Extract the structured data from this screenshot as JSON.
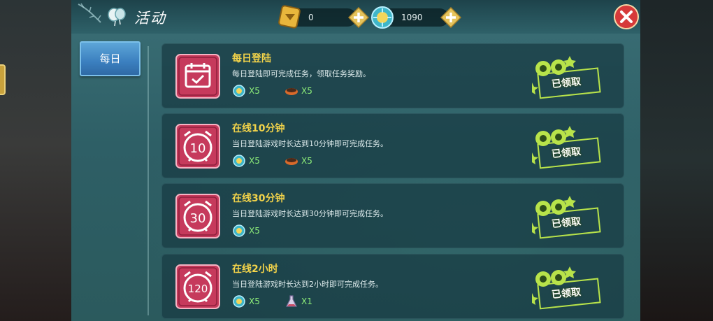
{
  "header": {
    "title": "活动",
    "gold": {
      "value": "0",
      "icon": "gold-ingot-icon"
    },
    "coins": {
      "value": "1090",
      "icon": "coin-icon"
    }
  },
  "tabs": [
    {
      "label": "每日",
      "selected": true
    }
  ],
  "tasks": [
    {
      "icon_text": "",
      "icon": "calendar-icon",
      "title": "每日登陆",
      "desc": "每日登陆即可完成任务，领取任务奖励。",
      "rewards": [
        {
          "icon": "coin-icon",
          "count": "X5"
        },
        {
          "icon": "food-bowl-icon",
          "count": "X5"
        }
      ],
      "status": "已领取"
    },
    {
      "icon_text": "10",
      "icon": "alarm-clock-icon",
      "title": "在线10分钟",
      "desc": "当日登陆游戏时长达到10分钟即可完成任务。",
      "rewards": [
        {
          "icon": "coin-icon",
          "count": "X5"
        },
        {
          "icon": "food-bowl-icon",
          "count": "X5"
        }
      ],
      "status": "已领取"
    },
    {
      "icon_text": "30",
      "icon": "alarm-clock-icon",
      "title": "在线30分钟",
      "desc": "当日登陆游戏时长达到30分钟即可完成任务。",
      "rewards": [
        {
          "icon": "coin-icon",
          "count": "X5"
        }
      ],
      "status": "已领取"
    },
    {
      "icon_text": "120",
      "icon": "alarm-clock-icon",
      "title": "在线2小时",
      "desc": "当日登陆游戏时长达到2小时即可完成任务。",
      "rewards": [
        {
          "icon": "coin-icon",
          "count": "X5"
        },
        {
          "icon": "flask-icon",
          "count": "X1"
        }
      ],
      "status": "已领取"
    }
  ],
  "colors": {
    "panel": "#2e5f66",
    "row": "#173a42",
    "title_yellow": "#f2d34a",
    "reward_green": "#8ff07a",
    "tab_blue": "#3b7fbf",
    "close_red": "#d63a3a",
    "card_pink": "#c63a5c"
  }
}
